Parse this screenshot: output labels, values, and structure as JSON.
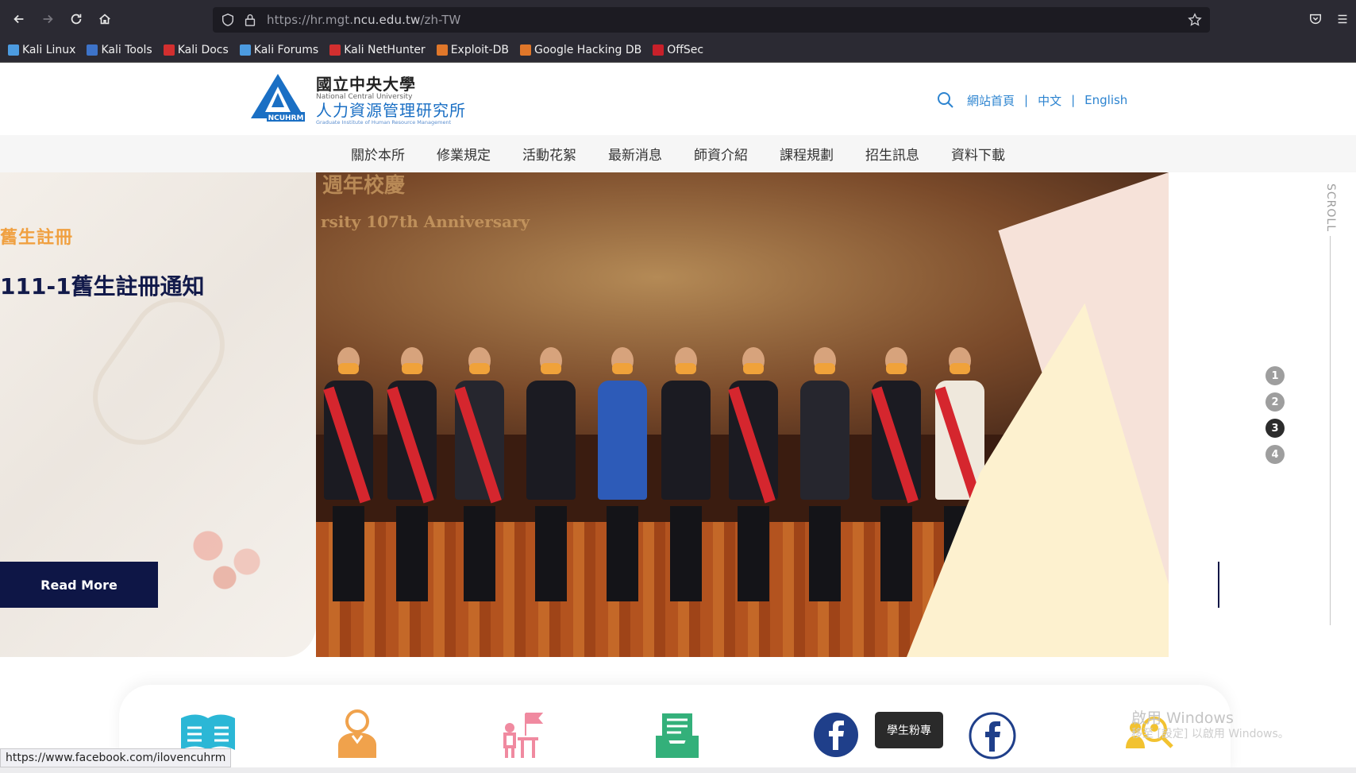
{
  "browser": {
    "url_prefix": "https://hr.mgt.",
    "url_domain": "ncu.edu.tw",
    "url_path": "/zh-TW",
    "bookmarks": [
      {
        "label": "Kali Linux",
        "color": "#4c9be0"
      },
      {
        "label": "Kali Tools",
        "color": "#3d73c9"
      },
      {
        "label": "Kali Docs",
        "color": "#d22f2f"
      },
      {
        "label": "Kali Forums",
        "color": "#4c9be0"
      },
      {
        "label": "Kali NetHunter",
        "color": "#d22f2f"
      },
      {
        "label": "Exploit-DB",
        "color": "#e0772a"
      },
      {
        "label": "Google Hacking DB",
        "color": "#e0772a"
      },
      {
        "label": "OffSec",
        "color": "#c8202a"
      }
    ]
  },
  "site": {
    "logo_zh_school": "國立中央大學",
    "logo_en_school": "National Central University",
    "logo_zh_dept": "人力資源管理研究所",
    "logo_en_dept": "Graduate Institute of Human Resource Management",
    "logo_mark_text": "NCUHRM",
    "util_links": [
      "網站首頁",
      "中文",
      "English"
    ],
    "nav": [
      "關於本所",
      "修業規定",
      "活動花絮",
      "最新消息",
      "師資介紹",
      "課程規劃",
      "招生訊息",
      "資料下載"
    ]
  },
  "hero": {
    "tag": "舊生註冊",
    "title": "111-1舊生註冊通知",
    "button": "Read More",
    "photo_banner": "rsity 107th Anniversary",
    "photo_banner_top": "週年校慶",
    "pager": [
      "1",
      "2",
      "3",
      "4"
    ],
    "active_page": "3",
    "scroll_label": "SCROLL"
  },
  "quick_links": {
    "tooltip": "學生粉專",
    "icons": [
      "book-icon",
      "person-icon",
      "flag-desk-icon",
      "inbox-icon",
      "facebook-icon",
      "facebook-outline-icon",
      "people-search-icon"
    ],
    "colors": {
      "cyan": "#2bb7d6",
      "orange": "#f0a24c",
      "pink": "#f08aa0",
      "green": "#33b07a",
      "navy": "#1f3f8a",
      "gold": "#f2c230"
    }
  },
  "overlay": {
    "activate_title": "啟用 Windows",
    "activate_sub": "移至 [設定] 以啟用 Windows。"
  },
  "status_bar": {
    "link": "https://www.facebook.com/ilovencuhrm"
  }
}
